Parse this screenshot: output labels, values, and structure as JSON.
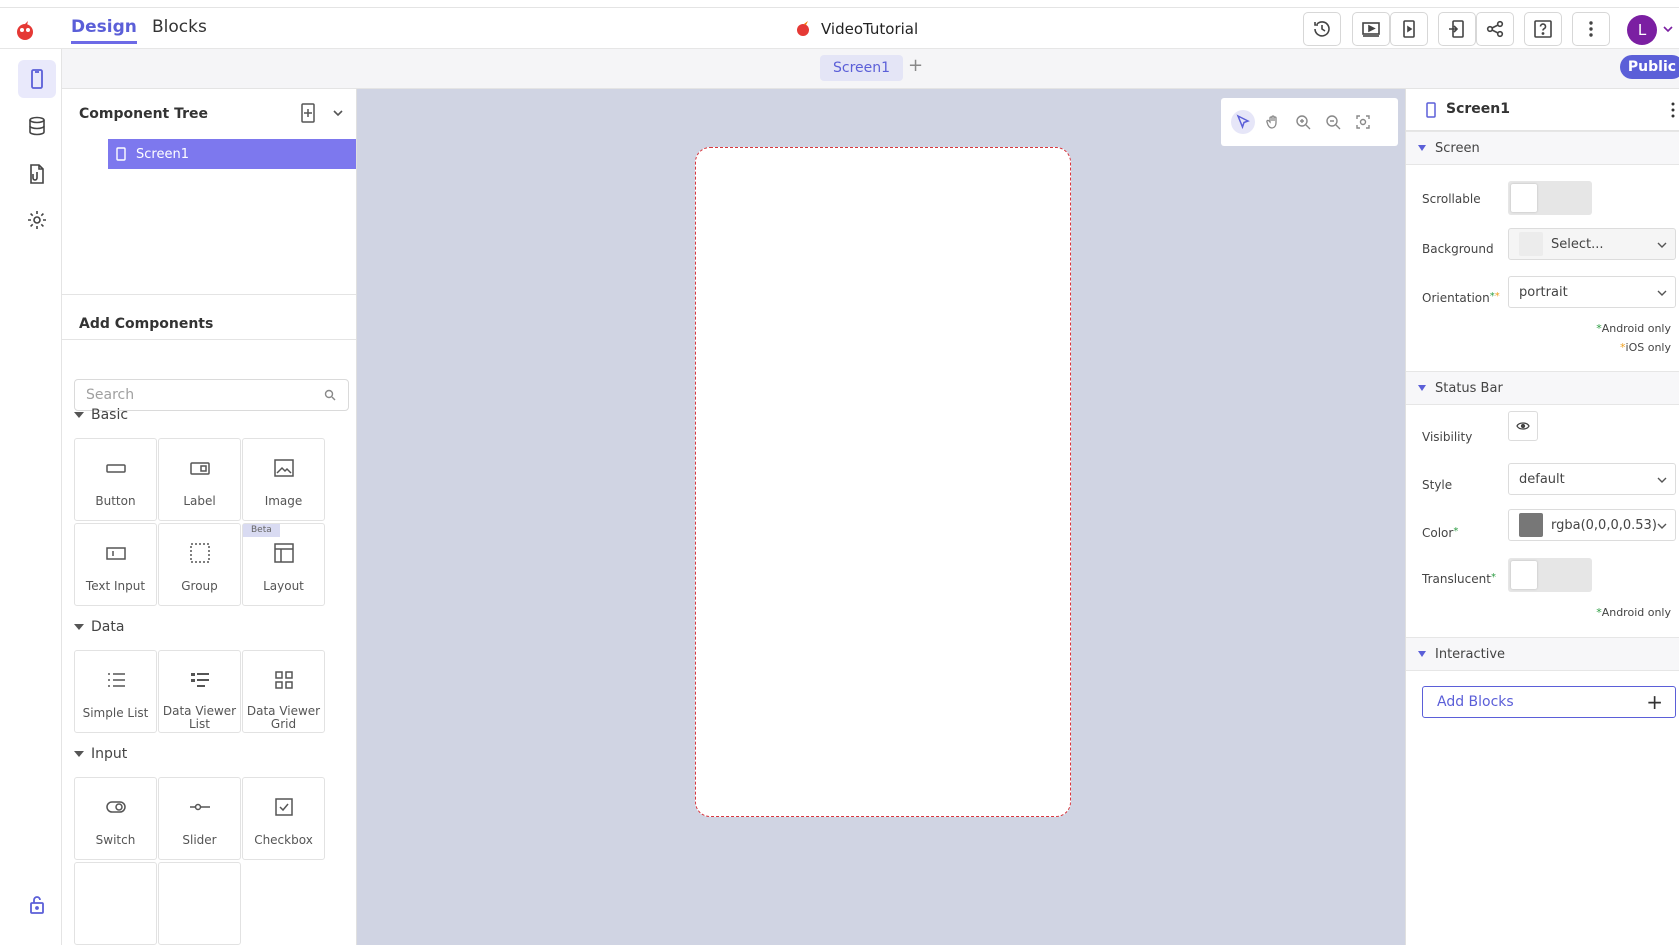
{
  "header": {
    "tabs": [
      "Design",
      "Blocks"
    ],
    "project_name": "VideoTutorial",
    "avatar_letter": "L"
  },
  "screen_bar": {
    "active_screen": "Screen1",
    "add_label": "+",
    "visibility_badge": "Public"
  },
  "left_panel": {
    "component_tree_title": "Component Tree",
    "tree_items": [
      "Screen1"
    ],
    "add_components_title": "Add Components",
    "search_placeholder": "Search",
    "categories": {
      "basic": {
        "label": "Basic",
        "items": [
          "Button",
          "Label",
          "Image",
          "Text Input",
          "Group",
          "Layout"
        ],
        "beta_tag": "Beta"
      },
      "data": {
        "label": "Data",
        "items": [
          "Simple List",
          "Data Viewer List",
          "Data Viewer Grid"
        ]
      },
      "input": {
        "label": "Input",
        "items": [
          "Switch",
          "Slider",
          "Checkbox"
        ]
      }
    }
  },
  "properties": {
    "title": "Screen1",
    "sections": {
      "screen": "Screen",
      "status_bar": "Status Bar",
      "interactive": "Interactive"
    },
    "scrollable_label": "Scrollable",
    "background_label": "Background",
    "background_value": "Select...",
    "orientation_label": "Orientation",
    "orientation_value": "portrait",
    "android_only": "Android only",
    "ios_only": "iOS only",
    "visibility_label": "Visibility",
    "style_label": "Style",
    "style_value": "default",
    "color_label": "Color",
    "color_value": "rgba(0,0,0,0.53)",
    "translucent_label": "Translucent",
    "add_blocks_label": "Add Blocks",
    "add_blocks_plus": "+"
  },
  "colors": {
    "accent": "#5b5fd8",
    "selected_row": "#7d78ee",
    "canvas_bg": "#d0d4e3",
    "android_marker": "#2e9e44",
    "ios_marker": "#f0a020",
    "status_bar_color": "#777777"
  },
  "icons": [
    "app-logo-icon",
    "history-icon",
    "preview-icon",
    "device-preview-icon",
    "export-icon",
    "share-icon",
    "help-icon",
    "more-vertical-icon",
    "phone-icon",
    "database-icon",
    "assets-icon",
    "gear-icon",
    "lock-icon",
    "add-screen-icon",
    "chevron-down-icon",
    "search-icon",
    "pointer-icon",
    "hand-icon",
    "zoom-in-icon",
    "zoom-out-icon",
    "fit-screen-icon",
    "eye-icon"
  ]
}
